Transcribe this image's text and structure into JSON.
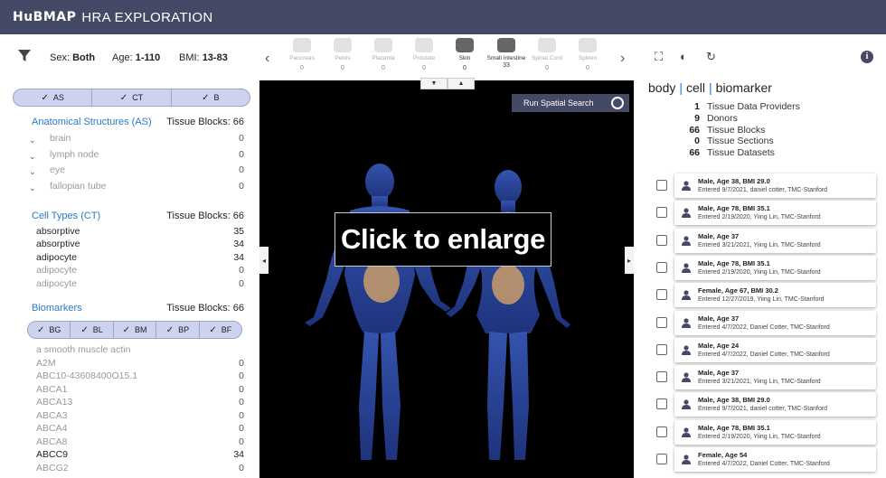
{
  "header": {
    "logo": "HuBMAP",
    "app_title": "HRA EXPLORATION"
  },
  "filters": {
    "sex_label": "Sex:",
    "sex_value": "Both",
    "age_label": "Age:",
    "age_value": "1-110",
    "bmi_label": "BMI:",
    "bmi_value": "13-83"
  },
  "organs": [
    {
      "name": "Pancreas",
      "count": "0"
    },
    {
      "name": "Pelvis",
      "count": "0"
    },
    {
      "name": "Placenta",
      "count": "0"
    },
    {
      "name": "Prostate",
      "count": "0"
    },
    {
      "name": "Skin",
      "count": "0",
      "active": true
    },
    {
      "name": "Small Intestine",
      "count": "33",
      "active": true
    },
    {
      "name": "Spinal Cord",
      "count": "0"
    },
    {
      "name": "Spleen",
      "count": "0"
    }
  ],
  "toggles_main": [
    "AS",
    "CT",
    "B"
  ],
  "anatomical": {
    "title": "Anatomical Structures (AS)",
    "blocks": "Tissue Blocks: 66",
    "items": [
      {
        "label": "brain",
        "value": "0"
      },
      {
        "label": "lymph node",
        "value": "0"
      },
      {
        "label": "eye",
        "value": "0"
      },
      {
        "label": "fallopian tube",
        "value": "0"
      }
    ]
  },
  "cell_types": {
    "title": "Cell Types (CT)",
    "blocks": "Tissue Blocks: 66",
    "items": [
      {
        "label": "absorptive",
        "value": "35"
      },
      {
        "label": "absorptive",
        "value": "34"
      },
      {
        "label": "adipocyte",
        "value": "34"
      },
      {
        "label": "adipocyte",
        "value": "0"
      },
      {
        "label": "adipocyte",
        "value": "0"
      }
    ]
  },
  "biomarkers": {
    "title": "Biomarkers",
    "blocks": "Tissue Blocks: 66",
    "toggles": [
      "BG",
      "BL",
      "BM",
      "BP",
      "BF"
    ],
    "items": [
      {
        "label": "a smooth muscle actin",
        "value": ""
      },
      {
        "label": "A2M",
        "value": "0"
      },
      {
        "label": "ABC10-43608400O15.1",
        "value": "0"
      },
      {
        "label": "ABCA1",
        "value": "0"
      },
      {
        "label": "ABCA13",
        "value": "0"
      },
      {
        "label": "ABCA3",
        "value": "0"
      },
      {
        "label": "ABCA4",
        "value": "0"
      },
      {
        "label": "ABCA8",
        "value": "0"
      },
      {
        "label": "ABCC9",
        "value": "34"
      },
      {
        "label": "ABCG2",
        "value": "0"
      }
    ]
  },
  "viewer": {
    "spatial_search": "Run Spatial Search",
    "enlarge_text": "Click to enlarge"
  },
  "breadcrumb": [
    "body",
    "cell",
    "biomarker"
  ],
  "stats": [
    {
      "n": "1",
      "label": "Tissue Data Providers"
    },
    {
      "n": "9",
      "label": "Donors"
    },
    {
      "n": "66",
      "label": "Tissue Blocks"
    },
    {
      "n": "0",
      "label": "Tissue Sections"
    },
    {
      "n": "66",
      "label": "Tissue Datasets"
    }
  ],
  "donors": [
    {
      "title": "Male, Age 38, BMI 29.0",
      "sub": "Entered 9/7/2021, daniel cotter, TMC-Stanford"
    },
    {
      "title": "Male, Age 78, BMI 35.1",
      "sub": "Entered 2/19/2020, Yiing Lin, TMC-Stanford"
    },
    {
      "title": "Male, Age 37",
      "sub": "Entered 3/21/2021, Yiing Lin, TMC-Stanford"
    },
    {
      "title": "Male, Age 78, BMI 35.1",
      "sub": "Entered 2/19/2020, Yiing Lin, TMC-Stanford"
    },
    {
      "title": "Female, Age 67, BMI 30.2",
      "sub": "Entered 12/27/2019, Yiing Lin, TMC-Stanford"
    },
    {
      "title": "Male, Age 37",
      "sub": "Entered 4/7/2022, Daniel Cotter, TMC-Stanford"
    },
    {
      "title": "Male, Age 24",
      "sub": "Entered 4/7/2022, Daniel Cotter, TMC-Stanford"
    },
    {
      "title": "Male, Age 37",
      "sub": "Entered 3/21/2021, Yiing Lin, TMC-Stanford"
    },
    {
      "title": "Male, Age 38, BMI 29.0",
      "sub": "Entered 9/7/2021, daniel cotter, TMC-Stanford"
    },
    {
      "title": "Male, Age 78, BMI 35.1",
      "sub": "Entered 2/19/2020, Yiing Lin, TMC-Stanford"
    },
    {
      "title": "Female, Age 54",
      "sub": "Entered 4/7/2022, Daniel Cotter, TMC-Stanford"
    }
  ],
  "colors": {
    "header": "#444a65",
    "link": "#2a78c8",
    "toggle": "#cdd2ee",
    "body_model": "#2a4aa0"
  }
}
